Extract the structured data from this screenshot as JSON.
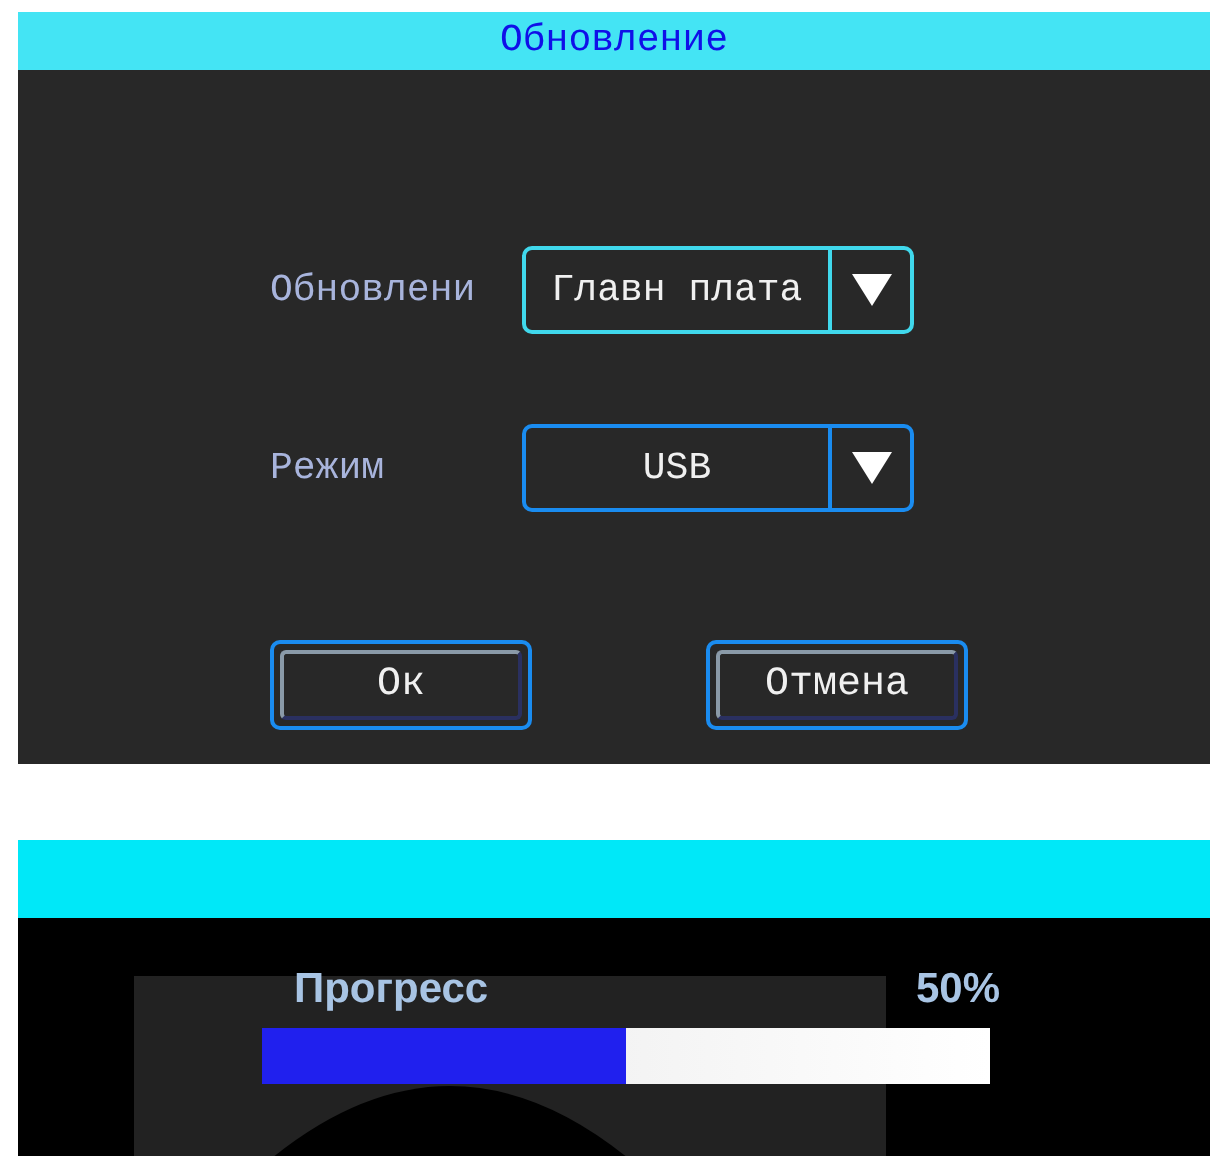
{
  "update_dialog": {
    "title": "Обновление",
    "fields": [
      {
        "label": "Обновлени",
        "value": "Главн плата",
        "focused": true
      },
      {
        "label": "Режим",
        "value": "USB",
        "focused": false
      }
    ],
    "buttons": [
      "Ок",
      "Отмена"
    ]
  },
  "progress_screen": {
    "label": "Прогресс",
    "reading": "50%",
    "level": 0.5
  }
}
